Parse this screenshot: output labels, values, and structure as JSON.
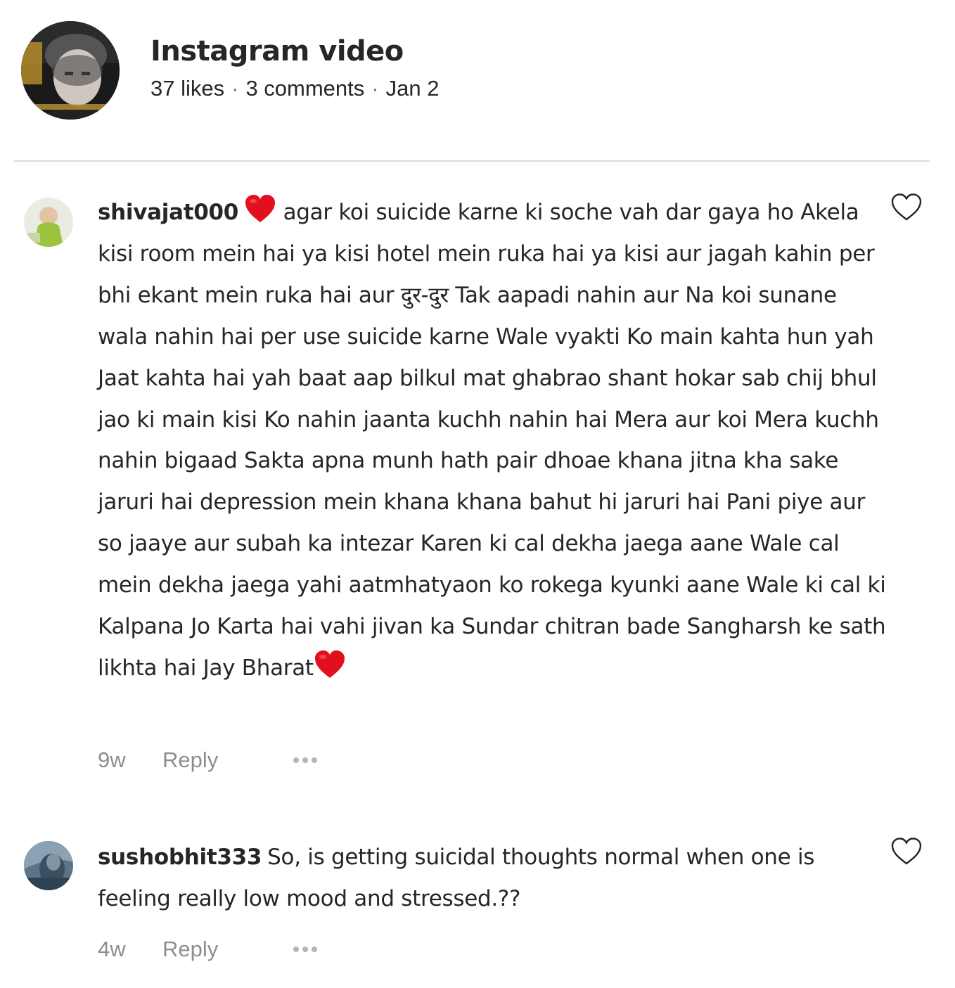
{
  "header": {
    "title": "Instagram video",
    "likes": "37 likes",
    "comments": "3 comments",
    "date": "Jan 2",
    "separator": "·"
  },
  "comments": [
    {
      "username": "shivajat000",
      "text_before_emoji": "agar koi suicide karne ki soche vah dar gaya ho Akela kisi room mein hai ya kisi hotel mein ruka hai ya kisi aur jagah kahin per bhi ekant mein ruka hai aur दुर-दुर Tak aapadi nahin aur Na koi sunane wala nahin hai per use suicide karne Wale vyakti Ko main kahta hun yah Jaat kahta hai yah baat aap bilkul mat ghabrao shant hokar sab chij bhul jao ki main kisi Ko nahin jaanta kuchh nahin hai Mera aur koi Mera kuchh nahin bigaad Sakta apna munh hath pair dhoae khana jitna kha sake jaruri hai depression mein khana khana bahut hi jaruri hai Pani piye aur so jaaye aur subah ka intezar Karen ki cal dekha jaega aane Wale cal mein dekha jaega yahi aatmhatyaon ko rokega kyunki aane Wale ki cal ki Kalpana Jo Karta hai vahi jivan ka Sundar chitran bade Sangharsh ke sath likhta hai Jay Bharat",
      "leading_emoji": "heart-emoji",
      "trailing_emoji": "heart-emoji",
      "time": "9w",
      "reply_label": "Reply"
    },
    {
      "username": "sushobhit333",
      "text": "So, is getting suicidal thoughts normal when one is feeling really low mood and stressed.??",
      "time": "4w",
      "reply_label": "Reply"
    }
  ],
  "colors": {
    "text": "#262626",
    "muted": "#8e8e8e",
    "divider": "#dbdbdb",
    "heart_red": "#e0101e"
  },
  "icons": {
    "like": "heart-outline-icon",
    "more": "more-horizontal-icon"
  }
}
